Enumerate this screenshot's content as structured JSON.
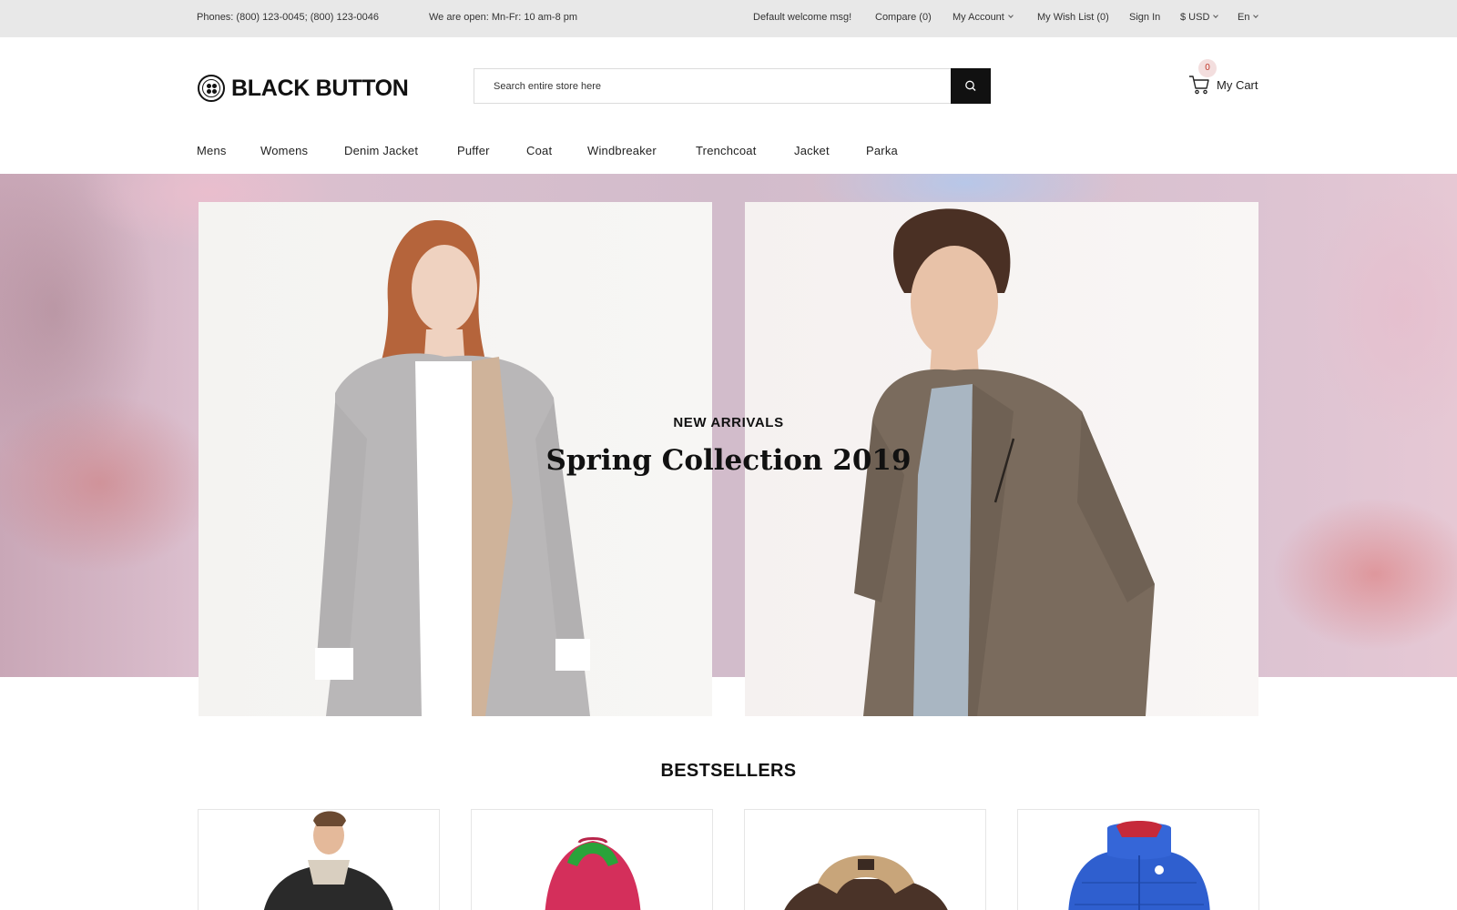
{
  "topbar": {
    "phones": "Phones: (800) 123-0045; (800) 123-0046",
    "hours": "We are open: Mn-Fr: 10 am-8 pm",
    "welcome": "Default welcome msg!",
    "compare": "Compare (0)",
    "account": "My Account",
    "wishlist": "My Wish List (0)",
    "signin": "Sign In",
    "currency": "$ USD",
    "language": "En"
  },
  "header": {
    "logo_text": "BLACK BUTTON",
    "search_placeholder": "Search entire store here",
    "search_value": "",
    "cart_count": "0",
    "cart_label": "My Cart"
  },
  "nav": {
    "items": [
      {
        "label": "Mens"
      },
      {
        "label": "Womens"
      },
      {
        "label": "Denim Jacket"
      },
      {
        "label": "Puffer"
      },
      {
        "label": "Coat"
      },
      {
        "label": "Windbreaker"
      },
      {
        "label": "Trenchcoat"
      },
      {
        "label": "Jacket"
      },
      {
        "label": "Parka"
      }
    ]
  },
  "hero": {
    "kicker": "NEW ARRIVALS",
    "title": "Spring Collection 2019"
  },
  "bestsellers": {
    "title": "BESTSELLERS"
  },
  "colors": {
    "topbar_bg": "#e8e8e8",
    "button_dark": "#111111",
    "cart_badge_bg": "#f3dede",
    "cart_badge_text": "#c0392b"
  }
}
